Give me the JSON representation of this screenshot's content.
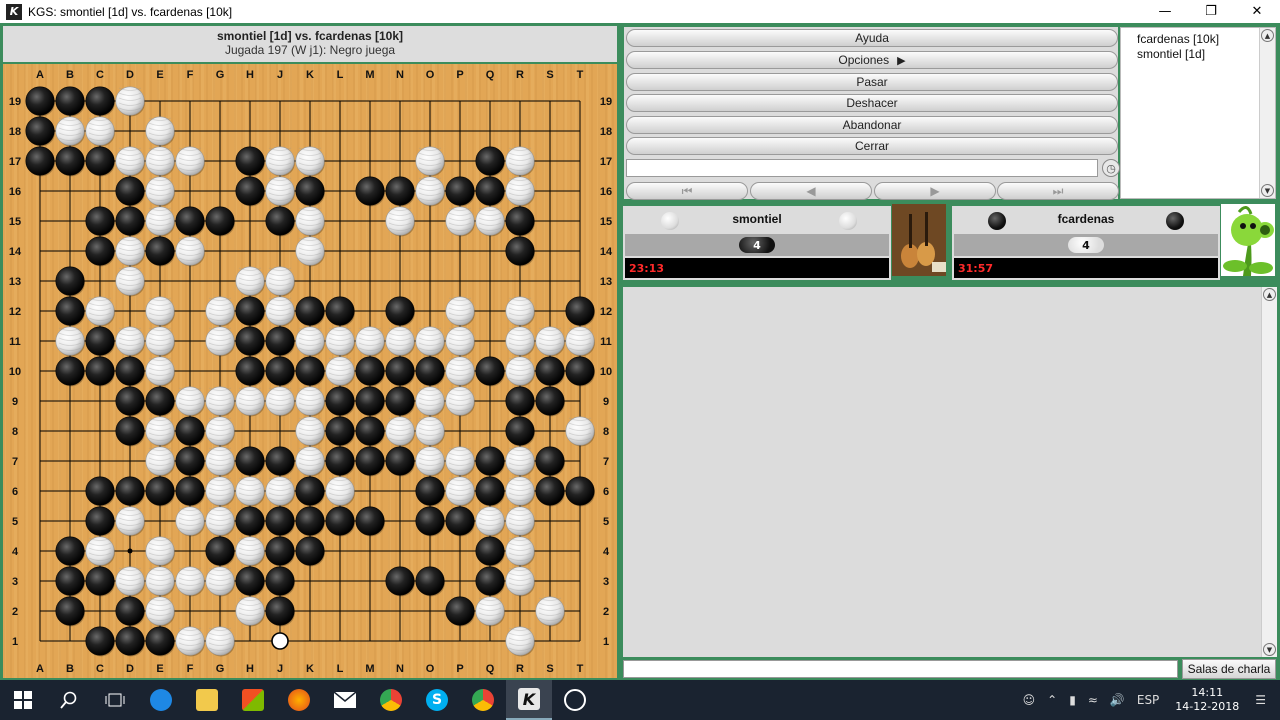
{
  "window": {
    "title": "KGS: smontiel [1d] vs. fcardenas [10k]",
    "icon_label": "K",
    "controls": [
      "minimize-icon",
      "restore-icon",
      "close-icon"
    ]
  },
  "game": {
    "players_line": "smontiel [1d] vs. fcardenas [10k]",
    "move_line": "Jugada 197 (W j1): Negro juega",
    "columns": [
      "A",
      "B",
      "C",
      "D",
      "E",
      "F",
      "G",
      "H",
      "J",
      "K",
      "L",
      "M",
      "N",
      "O",
      "P",
      "Q",
      "R",
      "S",
      "T"
    ],
    "rows": [
      "19",
      "18",
      "17",
      "16",
      "15",
      "14",
      "13",
      "12",
      "11",
      "10",
      "9",
      "8",
      "7",
      "6",
      "5",
      "4",
      "3",
      "2",
      "1"
    ],
    "stones": [
      "B|A19",
      "B|B19",
      "B|C19",
      "W|D19",
      "B|A18",
      "W|B18",
      "W|C18",
      "W|E18",
      "B|A17",
      "B|B17",
      "B|C17",
      "W|D17",
      "W|E17",
      "W|F17",
      "B|H17",
      "W|J17",
      "W|K17",
      "W|O17",
      "B|Q17",
      "W|R17",
      "B|D16",
      "W|E16",
      "B|H16",
      "W|J16",
      "B|K16",
      "B|M16",
      "B|N16",
      "W|O16",
      "B|P16",
      "B|Q16",
      "W|R16",
      "B|C15",
      "B|D15",
      "W|E15",
      "B|F15",
      "B|G15",
      "B|J15",
      "W|K15",
      "W|N15",
      "W|P15",
      "W|Q15",
      "B|R15",
      "B|C14",
      "W|D14",
      "B|E14",
      "W|F14",
      "W|K14",
      "B|R14",
      "B|B13",
      "W|D13",
      "W|H13",
      "W|J13",
      "B|B12",
      "W|C12",
      "W|E12",
      "W|G12",
      "B|H12",
      "W|J12",
      "B|K12",
      "B|L12",
      "B|N12",
      "W|P12",
      "W|R12",
      "B|T12",
      "W|B11",
      "B|C11",
      "W|D11",
      "W|E11",
      "W|G11",
      "B|H11",
      "B|J11",
      "W|K11",
      "W|L11",
      "W|M11",
      "W|N11",
      "W|O11",
      "W|P11",
      "W|R11",
      "W|S11",
      "W|T11",
      "B|B10",
      "B|C10",
      "B|D10",
      "W|E10",
      "B|H10",
      "B|J10",
      "B|K10",
      "W|L10",
      "B|M10",
      "B|N10",
      "B|O10",
      "W|P10",
      "B|Q10",
      "W|R10",
      "B|S10",
      "B|T10",
      "B|D9",
      "B|E9",
      "W|F9",
      "W|G9",
      "W|H9",
      "W|J9",
      "W|K9",
      "B|L9",
      "B|M9",
      "B|N9",
      "W|O9",
      "W|P9",
      "B|R9",
      "B|S9",
      "B|D8",
      "W|E8",
      "B|F8",
      "W|G8",
      "W|K8",
      "B|L8",
      "B|M8",
      "W|N8",
      "W|O8",
      "B|R8",
      "W|T8",
      "W|E7",
      "B|F7",
      "W|G7",
      "B|H7",
      "B|J7",
      "W|K7",
      "B|L7",
      "B|M7",
      "B|N7",
      "W|O7",
      "W|P7",
      "B|Q7",
      "W|R7",
      "B|S7",
      "B|C6",
      "B|D6",
      "B|E6",
      "B|F6",
      "W|G6",
      "W|H6",
      "W|J6",
      "B|K6",
      "W|L6",
      "B|O6",
      "W|P6",
      "B|Q6",
      "W|R6",
      "B|S6",
      "B|T6",
      "B|C5",
      "W|D5",
      "W|F5",
      "W|G5",
      "B|H5",
      "B|J5",
      "B|K5",
      "B|L5",
      "B|M5",
      "B|O5",
      "B|P5",
      "W|Q5",
      "W|R5",
      "B|B4",
      "W|C4",
      "W|E4",
      "B|G4",
      "W|H4",
      "B|J4",
      "B|K4",
      "B|Q4",
      "W|R4",
      "B|B3",
      "B|C3",
      "W|D3",
      "W|E3",
      "W|F3",
      "W|G3",
      "B|H3",
      "B|J3",
      "B|N3",
      "B|O3",
      "B|Q3",
      "W|R3",
      "B|B2",
      "B|D2",
      "W|E2",
      "W|H2",
      "B|J2",
      "B|P2",
      "W|Q2",
      "W|S2",
      "B|C1",
      "B|D1",
      "B|E1",
      "W|F1",
      "W|G1",
      "W|R1"
    ],
    "last_move": "J1"
  },
  "actions": {
    "help": "Ayuda",
    "options": "Opciones",
    "pass": "Pasar",
    "undo": "Deshacer",
    "resign": "Abandonar",
    "close": "Cerrar"
  },
  "nav": {
    "first": "⏮",
    "prev": "◀",
    "next": "▶",
    "last": "⏭"
  },
  "players_list": [
    "fcardenas [10k]",
    "smontiel [1d]"
  ],
  "white_player": {
    "name": "smontiel",
    "captures": "4",
    "clock": "23:13"
  },
  "black_player": {
    "name": "fcardenas",
    "captures": "4",
    "clock": "31:57"
  },
  "chat": {
    "rooms_button": "Salas de charla"
  },
  "taskbar": {
    "apps": [
      "windows-start-icon",
      "search-icon",
      "task-view-icon",
      "edge-icon",
      "file-explorer-icon",
      "store-icon",
      "firefox-icon",
      "mail-icon",
      "chrome-icon",
      "skype-icon",
      "chrome-icon",
      "kgs-icon",
      "clock-app-icon"
    ],
    "language": "ESP",
    "time": "14:11",
    "date": "14-12-2018"
  },
  "colors": {
    "frame": "#3c8c5c",
    "board": "#e2a655",
    "clock_text": "#ff2a2a"
  }
}
